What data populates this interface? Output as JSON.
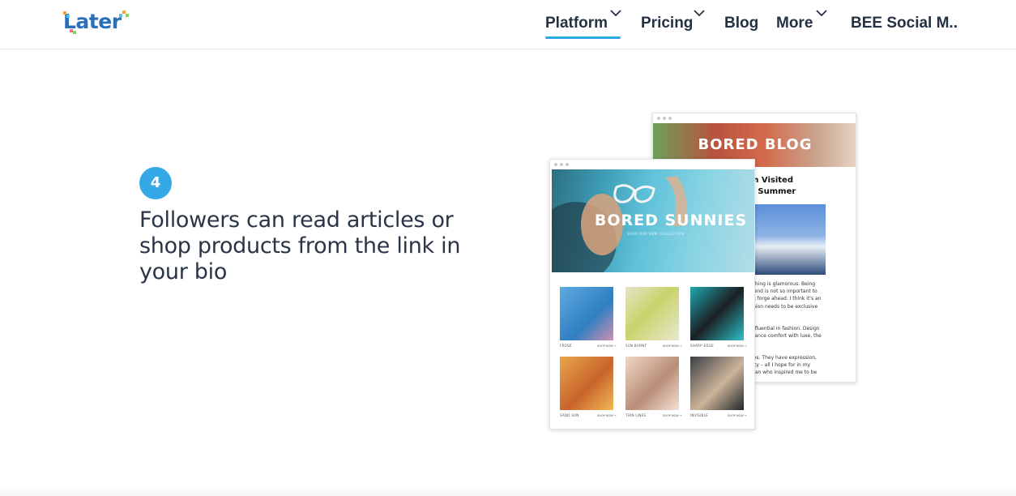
{
  "header": {
    "logo_text": "Later",
    "nav": [
      {
        "label": "Platform",
        "has_dropdown": true,
        "active": true
      },
      {
        "label": "Pricing",
        "has_dropdown": true,
        "active": false
      },
      {
        "label": "Blog",
        "has_dropdown": false,
        "active": false
      },
      {
        "label": "More",
        "has_dropdown": true,
        "active": false
      },
      {
        "label": "BEE Social M..",
        "has_dropdown": false,
        "active": false
      }
    ],
    "colors": {
      "accent": "#2ba8e6",
      "nav_text": "#243142",
      "logo_blue": "#2a6fb8"
    }
  },
  "step": {
    "number": "4",
    "text": "Followers can read articles or shop products from the link in your bio",
    "badge_color": "#35a8e6"
  },
  "mockups": {
    "blog": {
      "title": "BORED BLOG",
      "headline_line1": "m Visited",
      "headline_line2": "s Summer",
      "body_para1": [
        "ything is glamorous. Being",
        "trend is not so important to",
        "ys forge ahead. I think it's an",
        "shion needs to be exclusive"
      ],
      "body_para2": [
        "influential in fashion. Design",
        "alance comfort with luxe, the"
      ],
      "body_para3": [
        "ans. They have expression,",
        "city – all I hope for in my",
        "man who inspired me to be"
      ]
    },
    "shop": {
      "title": "BORED SUNNIES",
      "subtitle": "SHOP OUR NEW COLLECTION",
      "link_text": "SHOP NOW →",
      "products": [
        {
          "name": "FROSÉ"
        },
        {
          "name": "SUN BURNT"
        },
        {
          "name": "SHARP EDGE"
        },
        {
          "name": "SAND SUN"
        },
        {
          "name": "THIN LINES"
        },
        {
          "name": "INVISIBLE"
        }
      ]
    }
  }
}
